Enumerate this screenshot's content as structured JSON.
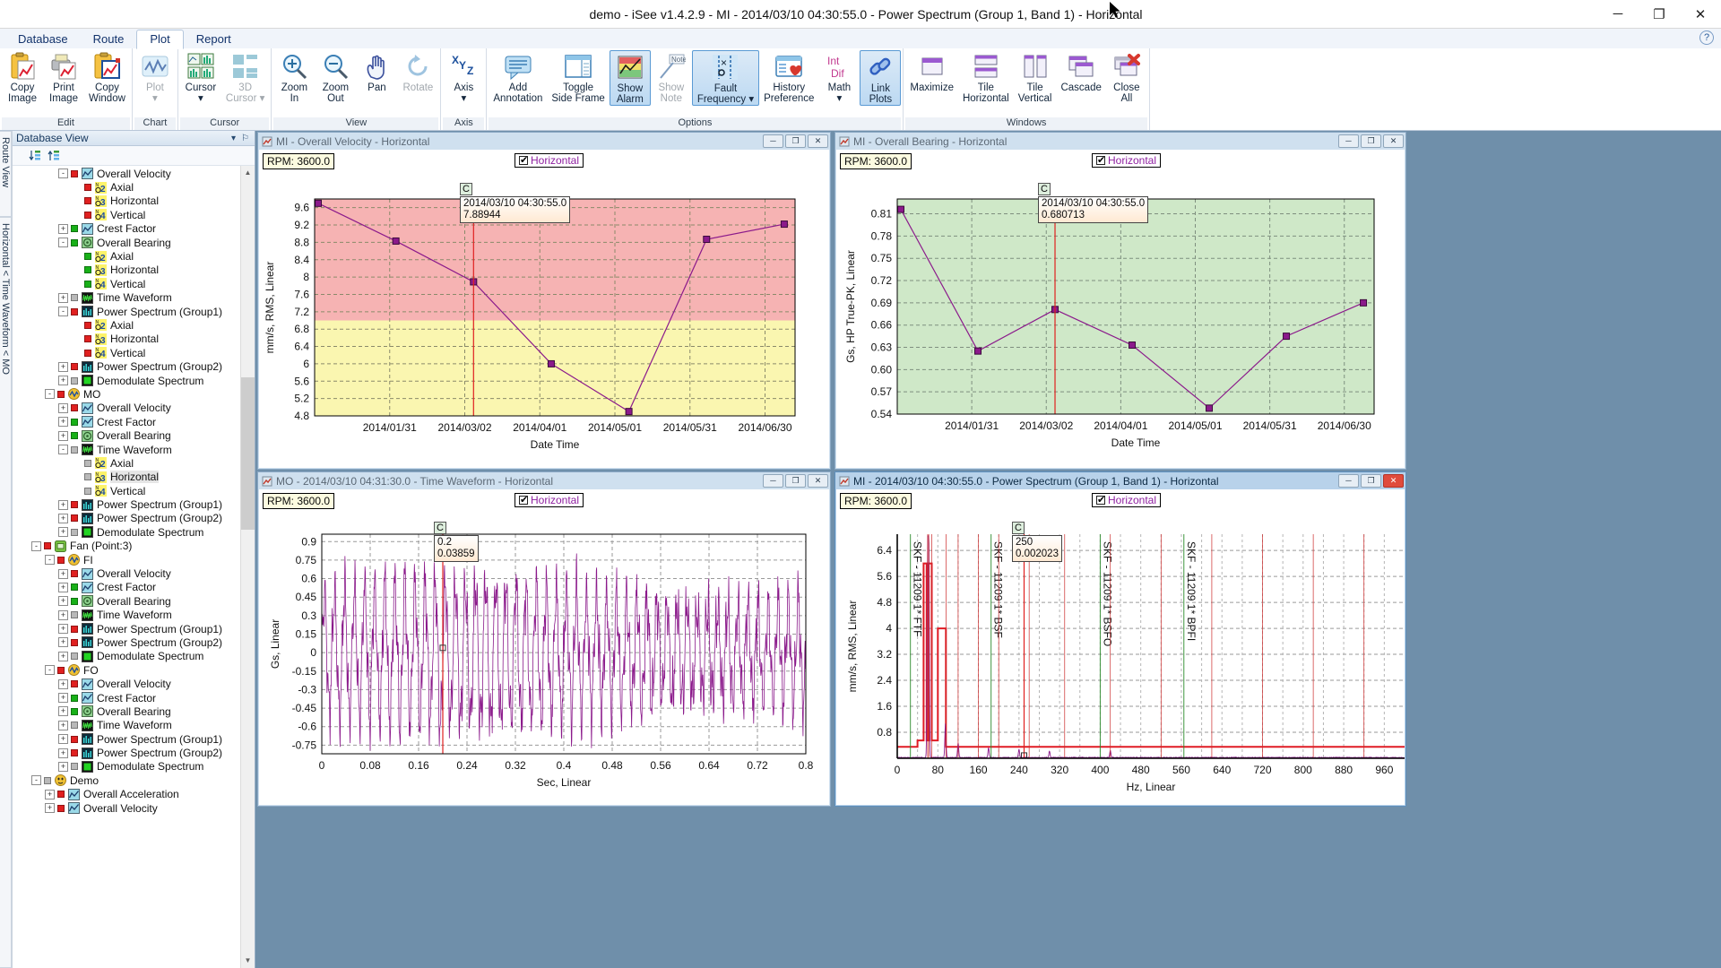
{
  "window": {
    "title": "demo - iSee v1.4.2.9 - MI - 2014/03/10 04:30:55.0 - Power Spectrum (Group 1, Band 1) - Horizontal",
    "minimize": "─",
    "maximize": "❐",
    "close": "✕"
  },
  "menu": {
    "tabs": [
      "Database",
      "Route",
      "Plot",
      "Report"
    ],
    "active": "Plot",
    "help": "?"
  },
  "ribbon": {
    "groups": [
      {
        "name": "Edit",
        "buttons": [
          {
            "icon": "copy-image-icon",
            "l1": "Copy",
            "l2": "Image",
            "state": "normal"
          },
          {
            "icon": "print-image-icon",
            "l1": "Print",
            "l2": "Image",
            "state": "normal"
          },
          {
            "icon": "copy-window-icon",
            "l1": "Copy",
            "l2": "Window",
            "state": "normal"
          }
        ]
      },
      {
        "name": "Chart",
        "buttons": [
          {
            "icon": "plot-icon",
            "l1": "Plot",
            "l2": "▾",
            "state": "dim"
          }
        ]
      },
      {
        "name": "Cursor",
        "buttons": [
          {
            "icon": "cursor-icon",
            "l1": "Cursor",
            "l2": "▾",
            "state": "normal"
          },
          {
            "icon": "cursor3d-icon",
            "l1": "3D",
            "l2": "Cursor ▾",
            "state": "dim"
          }
        ]
      },
      {
        "name": "View",
        "buttons": [
          {
            "icon": "zoom-in-icon",
            "l1": "Zoom",
            "l2": "In",
            "state": "normal"
          },
          {
            "icon": "zoom-out-icon",
            "l1": "Zoom",
            "l2": "Out",
            "state": "normal"
          },
          {
            "icon": "pan-icon",
            "l1": "Pan",
            "l2": "",
            "state": "normal"
          },
          {
            "icon": "rotate-icon",
            "l1": "Rotate",
            "l2": "",
            "state": "dim"
          }
        ]
      },
      {
        "name": "Axis",
        "buttons": [
          {
            "icon": "axis-xyz-icon",
            "l1": "Axis",
            "l2": "▾",
            "state": "normal"
          }
        ]
      },
      {
        "name": "Options",
        "buttons": [
          {
            "icon": "add-annotation-icon",
            "l1": "Add",
            "l2": "Annotation",
            "state": "normal"
          },
          {
            "icon": "toggle-side-frame-icon",
            "l1": "Toggle",
            "l2": "Side Frame",
            "state": "normal"
          },
          {
            "icon": "show-alarm-icon",
            "l1": "Show",
            "l2": "Alarm",
            "state": "selected"
          },
          {
            "icon": "show-note-icon",
            "l1": "Show",
            "l2": "Note",
            "state": "dim"
          },
          {
            "icon": "fault-frequency-icon",
            "l1": "Fault",
            "l2": "Frequency ▾",
            "state": "selected"
          },
          {
            "icon": "history-preference-icon",
            "l1": "History",
            "l2": "Preference",
            "state": "normal"
          },
          {
            "icon": "math-int-dif-icon",
            "l1": "Math",
            "l2": "▾",
            "state": "normal"
          },
          {
            "icon": "link-plots-icon",
            "l1": "Link",
            "l2": "Plots",
            "state": "selected"
          }
        ]
      },
      {
        "name": "Windows",
        "buttons": [
          {
            "icon": "maximize-window-icon",
            "l1": "Maximize",
            "l2": "",
            "state": "normal"
          },
          {
            "icon": "tile-horizontal-icon",
            "l1": "Tile",
            "l2": "Horizontal",
            "state": "normal"
          },
          {
            "icon": "tile-vertical-icon",
            "l1": "Tile",
            "l2": "Vertical",
            "state": "normal"
          },
          {
            "icon": "cascade-icon",
            "l1": "Cascade",
            "l2": "",
            "state": "normal"
          },
          {
            "icon": "close-all-icon",
            "l1": "Close",
            "l2": "All",
            "state": "normal"
          }
        ]
      }
    ]
  },
  "leftrail": {
    "tabs": [
      "Route View",
      "Horizontal < Time Waveform < MO"
    ]
  },
  "tree": {
    "header": "Database View",
    "header_buttons": [
      "▾",
      "⚐"
    ],
    "toolbar_icons": [
      "collapse-all-icon",
      "expand-all-icon"
    ],
    "rows": [
      {
        "indent": 3,
        "exp": "-",
        "sq": "red",
        "icon": "trend-icon",
        "label": "Overall Velocity"
      },
      {
        "indent": 4,
        "exp": "",
        "sq": "red",
        "icon": "point-2",
        "label": "Axial"
      },
      {
        "indent": 4,
        "exp": "",
        "sq": "red",
        "icon": "point-3",
        "label": "Horizontal"
      },
      {
        "indent": 4,
        "exp": "",
        "sq": "red",
        "icon": "point-4",
        "label": "Vertical"
      },
      {
        "indent": 3,
        "exp": "+",
        "sq": "green",
        "icon": "trend-icon",
        "label": "Crest Factor"
      },
      {
        "indent": 3,
        "exp": "-",
        "sq": "green",
        "icon": "bearing-icon",
        "label": "Overall Bearing"
      },
      {
        "indent": 4,
        "exp": "",
        "sq": "green",
        "icon": "point-2",
        "label": "Axial"
      },
      {
        "indent": 4,
        "exp": "",
        "sq": "green",
        "icon": "point-3",
        "label": "Horizontal"
      },
      {
        "indent": 4,
        "exp": "",
        "sq": "green",
        "icon": "point-4",
        "label": "Vertical"
      },
      {
        "indent": 3,
        "exp": "+",
        "sq": "gray",
        "icon": "waveform-icon",
        "label": "Time Waveform"
      },
      {
        "indent": 3,
        "exp": "-",
        "sq": "red",
        "icon": "spectrum-icon",
        "label": "Power Spectrum (Group1)"
      },
      {
        "indent": 4,
        "exp": "",
        "sq": "red",
        "icon": "point-2",
        "label": "Axial"
      },
      {
        "indent": 4,
        "exp": "",
        "sq": "red",
        "icon": "point-3",
        "label": "Horizontal"
      },
      {
        "indent": 4,
        "exp": "",
        "sq": "red",
        "icon": "point-4",
        "label": "Vertical"
      },
      {
        "indent": 3,
        "exp": "+",
        "sq": "red",
        "icon": "spectrum-icon",
        "label": "Power Spectrum (Group2)"
      },
      {
        "indent": 3,
        "exp": "+",
        "sq": "gray",
        "icon": "demod-icon",
        "label": "Demodulate Spectrum"
      },
      {
        "indent": 2,
        "exp": "-",
        "sq": "red",
        "icon": "measpoint-icon",
        "label": "MO"
      },
      {
        "indent": 3,
        "exp": "+",
        "sq": "red",
        "icon": "trend-icon",
        "label": "Overall Velocity"
      },
      {
        "indent": 3,
        "exp": "+",
        "sq": "green",
        "icon": "trend-icon",
        "label": "Crest Factor"
      },
      {
        "indent": 3,
        "exp": "+",
        "sq": "green",
        "icon": "bearing-icon",
        "label": "Overall Bearing"
      },
      {
        "indent": 3,
        "exp": "-",
        "sq": "gray",
        "icon": "waveform-icon",
        "label": "Time Waveform"
      },
      {
        "indent": 4,
        "exp": "",
        "sq": "gray",
        "icon": "point-2",
        "label": "Axial"
      },
      {
        "indent": 4,
        "exp": "",
        "sq": "gray",
        "icon": "point-3",
        "label": "Horizontal",
        "selected": true
      },
      {
        "indent": 4,
        "exp": "",
        "sq": "gray",
        "icon": "point-4",
        "label": "Vertical"
      },
      {
        "indent": 3,
        "exp": "+",
        "sq": "red",
        "icon": "spectrum-icon",
        "label": "Power Spectrum (Group1)"
      },
      {
        "indent": 3,
        "exp": "+",
        "sq": "red",
        "icon": "spectrum-icon",
        "label": "Power Spectrum (Group2)"
      },
      {
        "indent": 3,
        "exp": "+",
        "sq": "gray",
        "icon": "demod-icon",
        "label": "Demodulate Spectrum"
      },
      {
        "indent": 1,
        "exp": "-",
        "sq": "red",
        "icon": "machine-icon",
        "label": "Fan (Point:3)"
      },
      {
        "indent": 2,
        "exp": "-",
        "sq": "red",
        "icon": "measpoint-icon",
        "label": "FI"
      },
      {
        "indent": 3,
        "exp": "+",
        "sq": "red",
        "icon": "trend-icon",
        "label": "Overall Velocity"
      },
      {
        "indent": 3,
        "exp": "+",
        "sq": "green",
        "icon": "trend-icon",
        "label": "Crest Factor"
      },
      {
        "indent": 3,
        "exp": "+",
        "sq": "green",
        "icon": "bearing-icon",
        "label": "Overall Bearing"
      },
      {
        "indent": 3,
        "exp": "+",
        "sq": "gray",
        "icon": "waveform-icon",
        "label": "Time Waveform"
      },
      {
        "indent": 3,
        "exp": "+",
        "sq": "red",
        "icon": "spectrum-icon",
        "label": "Power Spectrum (Group1)"
      },
      {
        "indent": 3,
        "exp": "+",
        "sq": "red",
        "icon": "spectrum-icon",
        "label": "Power Spectrum (Group2)"
      },
      {
        "indent": 3,
        "exp": "+",
        "sq": "gray",
        "icon": "demod-icon",
        "label": "Demodulate Spectrum"
      },
      {
        "indent": 2,
        "exp": "-",
        "sq": "red",
        "icon": "measpoint-icon",
        "label": "FO"
      },
      {
        "indent": 3,
        "exp": "+",
        "sq": "red",
        "icon": "trend-icon",
        "label": "Overall Velocity"
      },
      {
        "indent": 3,
        "exp": "+",
        "sq": "green",
        "icon": "trend-icon",
        "label": "Crest Factor"
      },
      {
        "indent": 3,
        "exp": "+",
        "sq": "green",
        "icon": "bearing-icon",
        "label": "Overall Bearing"
      },
      {
        "indent": 3,
        "exp": "+",
        "sq": "gray",
        "icon": "waveform-icon",
        "label": "Time Waveform"
      },
      {
        "indent": 3,
        "exp": "+",
        "sq": "red",
        "icon": "spectrum-icon",
        "label": "Power Spectrum (Group1)"
      },
      {
        "indent": 3,
        "exp": "+",
        "sq": "red",
        "icon": "spectrum-icon",
        "label": "Power Spectrum (Group2)"
      },
      {
        "indent": 3,
        "exp": "+",
        "sq": "gray",
        "icon": "demod-icon",
        "label": "Demodulate Spectrum"
      },
      {
        "indent": 1,
        "exp": "-",
        "sq": "gray",
        "icon": "machine-icon2",
        "label": "Demo"
      },
      {
        "indent": 2,
        "exp": "+",
        "sq": "red",
        "icon": "trend-icon",
        "label": "Overall Acceleration"
      },
      {
        "indent": 2,
        "exp": "+",
        "sq": "red",
        "icon": "trend-icon",
        "label": "Overall Velocity"
      }
    ]
  },
  "panes": [
    {
      "id": "overall-velocity",
      "title": "MI - Overall Velocity - Horizontal",
      "rpm": "RPM: 3600.0",
      "legend": "Horizontal",
      "buttons": [
        "─",
        "❐",
        "✕"
      ],
      "active": false
    },
    {
      "id": "overall-bearing",
      "title": "MI - Overall Bearing - Horizontal",
      "rpm": "RPM: 3600.0",
      "legend": "Horizontal",
      "buttons": [
        "─",
        "❐",
        "✕"
      ],
      "active": false
    },
    {
      "id": "time-waveform",
      "title": "MO - 2014/03/10 04:31:30.0 - Time Waveform - Horizontal",
      "rpm": "RPM: 3600.0",
      "legend": "Horizontal",
      "buttons": [
        "─",
        "❐",
        "✕"
      ],
      "active": false
    },
    {
      "id": "power-spectrum",
      "title": "MI - 2014/03/10 04:30:55.0 - Power Spectrum (Group 1, Band 1) - Horizontal",
      "rpm": "RPM: 3600.0",
      "legend": "Horizontal",
      "buttons": [
        "─",
        "❐",
        "✕"
      ],
      "active": true
    }
  ],
  "chart_data": [
    {
      "id": "overall-velocity",
      "type": "line",
      "title": "MI - Overall Velocity - Horizontal",
      "xlabel": "Date Time",
      "ylabel": "mm/s, RMS, Linear",
      "ylim": [
        4.8,
        9.8
      ],
      "yticks": [
        4.8,
        5.2,
        5.6,
        6,
        6.4,
        6.8,
        7.2,
        7.6,
        8,
        8.4,
        8.8,
        9.2,
        9.6
      ],
      "xticklabels": [
        "2014/01/31",
        "2014/03/02",
        "2014/04/01",
        "2014/05/01",
        "2014/05/31",
        "2014/06/30"
      ],
      "x": [
        "2014/01/01",
        "2014/02/15",
        "2014/03/10",
        "2014/04/10",
        "2014/05/12",
        "2014/06/12",
        "2014/07/10"
      ],
      "values": [
        9.7,
        8.83,
        7.89,
        6.0,
        4.9,
        8.87,
        9.22
      ],
      "series_color": "#8b1a8b",
      "alarm_bands": [
        {
          "from": 7.0,
          "to": 9.8,
          "color": "#f6b3b3",
          "label": "danger"
        },
        {
          "from": 4.8,
          "to": 7.0,
          "color": "#faf6b0",
          "label": "warning"
        }
      ],
      "cursor": {
        "label": "C",
        "x": "2014/03/10",
        "text1": "2014/03/10 04:30:55.0",
        "text2": "7.88944"
      },
      "grid": true
    },
    {
      "id": "overall-bearing",
      "type": "line",
      "title": "MI - Overall Bearing - Horizontal",
      "xlabel": "Date Time",
      "ylabel": "Gs, HP True-PK, Linear",
      "ylim": [
        0.54,
        0.83
      ],
      "yticks": [
        0.54,
        0.57,
        0.6,
        0.63,
        0.66,
        0.69,
        0.72,
        0.75,
        0.78,
        0.81
      ],
      "xticklabels": [
        "2014/01/31",
        "2014/03/02",
        "2014/04/01",
        "2014/05/01",
        "2014/05/31",
        "2014/06/30"
      ],
      "x": [
        "2014/01/01",
        "2014/02/15",
        "2014/03/10",
        "2014/04/10",
        "2014/05/12",
        "2014/06/12",
        "2014/07/10"
      ],
      "values": [
        0.816,
        0.625,
        0.681,
        0.633,
        0.548,
        0.645,
        0.69
      ],
      "series_color": "#8b1a8b",
      "alarm_bands": [
        {
          "from": 0.54,
          "to": 0.83,
          "color": "#cfe8c8",
          "label": "ok"
        }
      ],
      "cursor": {
        "label": "C",
        "x": "2014/03/10",
        "text1": "2014/03/10 04:30:55.0",
        "text2": "0.680713"
      },
      "grid": true
    },
    {
      "id": "time-waveform",
      "type": "line",
      "title": "MO - 2014/03/10 04:31:30.0 - Time Waveform - Horizontal",
      "xlabel": "Sec, Linear",
      "ylabel": "Gs, Linear",
      "ylim": [
        -0.82,
        0.96
      ],
      "yticks": [
        -0.75,
        -0.6,
        -0.45,
        -0.3,
        -0.15,
        0,
        0.15,
        0.3,
        0.45,
        0.6,
        0.75,
        0.9
      ],
      "xlim": [
        0,
        0.8
      ],
      "xticks": [
        0,
        0.08,
        0.16,
        0.24,
        0.32,
        0.4,
        0.48,
        0.56,
        0.64,
        0.72,
        0.8
      ],
      "series_color": "#8b1a8b",
      "cursor": {
        "label": "C",
        "x": 0.2,
        "text1": "0.2",
        "text2": "0.03859"
      },
      "grid": true
    },
    {
      "id": "power-spectrum",
      "type": "line",
      "title": "MI - 2014/03/10 04:30:55.0 - Power Spectrum (Group 1, Band 1) - Horizontal",
      "xlabel": "Hz, Linear",
      "ylabel": "mm/s, RMS, Linear",
      "ylim": [
        0,
        6.9
      ],
      "yticks": [
        0,
        0.8,
        1.6,
        2.4,
        3.2,
        4,
        4.8,
        5.6,
        6.4
      ],
      "xlim": [
        0,
        1000
      ],
      "xticks": [
        0,
        40,
        80,
        120,
        160,
        200,
        240,
        280,
        320,
        360,
        400,
        440,
        480,
        520,
        560,
        600,
        640,
        680,
        720,
        760,
        800,
        840,
        880,
        920,
        960
      ],
      "xticklabels": [
        "0",
        "80",
        "160",
        "240",
        "320",
        "400",
        "480",
        "560",
        "640",
        "720",
        "800",
        "880",
        "960"
      ],
      "series_color": "#8b1a8b",
      "band_color": "#e01b24",
      "peaks": [
        {
          "hz": 60,
          "amp": 5.95
        },
        {
          "hz": 62,
          "amp": 6.7
        },
        {
          "hz": 95,
          "amp": 1.05
        },
        {
          "hz": 120,
          "amp": 0.45
        },
        {
          "hz": 180,
          "amp": 0.3
        },
        {
          "hz": 240,
          "amp": 0.25
        },
        {
          "hz": 300,
          "amp": 0.2
        },
        {
          "hz": 420,
          "amp": 0.22
        }
      ],
      "fault_frequencies": [
        {
          "label": "SKF - 11209  1* FTF",
          "hz": 26
        },
        {
          "label": "SKF - 11209  1* BSF",
          "hz": 185
        },
        {
          "label": "SKF - 11209  1* BSFO",
          "hz": 400
        },
        {
          "label": "SKF - 11209  1* BPFI",
          "hz": 565
        }
      ],
      "cursor": {
        "label": "C",
        "x": 250,
        "text1": "250",
        "text2": "0.002023"
      },
      "grid": true
    }
  ]
}
